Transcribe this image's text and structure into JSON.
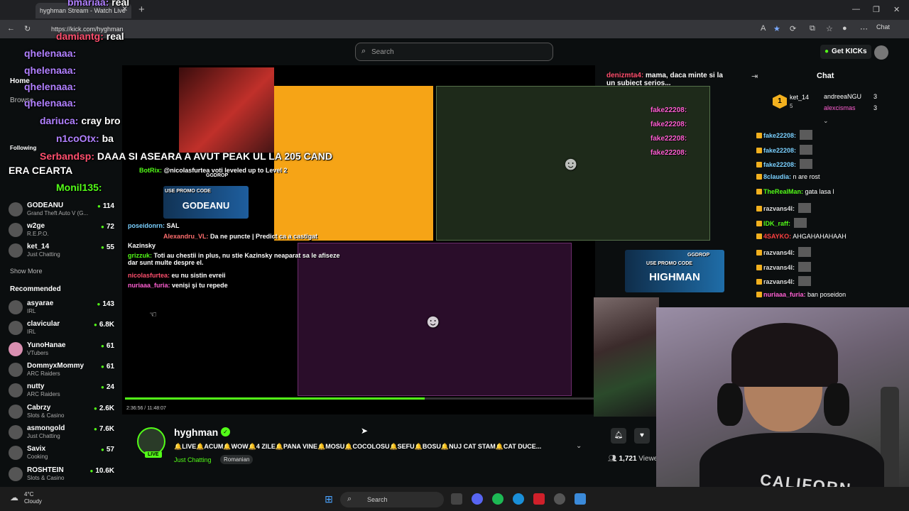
{
  "browser": {
    "tab_title": "hyghman Stream - Watch Live",
    "url": "https://kick.com/hyghman",
    "chat_button": "Chat"
  },
  "header": {
    "search_placeholder": "Search",
    "get_kicks": "Get KICKs"
  },
  "sidebar": {
    "nav": [
      "Home",
      "Browse"
    ],
    "following_label": "Following",
    "following": [
      {
        "name": "GODEANU",
        "category": "Grand Theft Auto V (G...",
        "viewers": "114"
      },
      {
        "name": "w2ge",
        "category": "R.E.P.O.",
        "viewers": "72"
      },
      {
        "name": "ket_14",
        "category": "Just Chatting",
        "viewers": "55"
      }
    ],
    "show_more": "Show More",
    "recommended_label": "Recommended",
    "recommended": [
      {
        "name": "asyarae",
        "category": "IRL",
        "viewers": "143"
      },
      {
        "name": "clavicular",
        "category": "IRL",
        "viewers": "6.8K"
      },
      {
        "name": "YunoHanae",
        "category": "VTubers",
        "viewers": "61"
      },
      {
        "name": "DommyxMommy",
        "category": "ARC Raiders",
        "viewers": "61"
      },
      {
        "name": "nutty",
        "category": "ARC Raiders",
        "viewers": "24"
      },
      {
        "name": "Cabrzy",
        "category": "Slots & Casino",
        "viewers": "2.6K"
      },
      {
        "name": "asmongold",
        "category": "Just Chatting",
        "viewers": "7.6K"
      },
      {
        "name": "Savix",
        "category": "Cooking",
        "viewers": "57"
      },
      {
        "name": "ROSHTEIN",
        "category": "Slots & Casino",
        "viewers": "10.6K"
      }
    ]
  },
  "overlay": {
    "lines": [
      {
        "user": "bmariaa:",
        "text": "real"
      },
      {
        "user": "damiantg:",
        "text": "real"
      },
      {
        "user": "qhelenaaa:",
        "text": ""
      },
      {
        "user": "qhelenaaa:",
        "text": ""
      },
      {
        "user": "qhelenaaa:",
        "text": ""
      },
      {
        "user": "qhelenaaa:",
        "text": ""
      },
      {
        "user": "dariuca:",
        "text": "cray bro"
      },
      {
        "user": "n1coOtx:",
        "text": "ba"
      },
      {
        "user": "Serbandsp:",
        "text": "DAAA SI ASEARA A AVUT PEAK UL LA 205 CAND"
      },
      {
        "user": "",
        "text": "ERA CEARTA"
      },
      {
        "user": "Monil135:",
        "text": ""
      }
    ],
    "top_right_chat": [
      {
        "user": "denizmta4:",
        "text": "mama, daca minte si la un subiect serios..."
      },
      {
        "user": "fake22208:",
        "text": ""
      },
      {
        "user": "fake22208:",
        "text": ""
      },
      {
        "user": "fake22208:",
        "text": ""
      },
      {
        "user": "fake22208:",
        "text": ""
      }
    ],
    "stream_chat": [
      {
        "user": "BotRix:",
        "text": "@nicolasfurtea voti leveled up to Level 2"
      },
      {
        "user": "poseidonrn:",
        "text": "SAL"
      },
      {
        "user": "Alexandru_VL:",
        "text": "Da ne puncte | Predict ca a castigat"
      },
      {
        "user": "Kazinsky",
        "text": ""
      },
      {
        "user": "grizzuk:",
        "text": "Toti au chestii in plus, nu stie Kazinsky neaparat sa le afiseze dar sunt multe despre el."
      },
      {
        "user": "nicolasfurtea:",
        "text": "eu nu sistin evreii"
      },
      {
        "user": "nuriaaa_furia:",
        "text": "venişi şi tu repede"
      }
    ],
    "promo_left": "GODEANU",
    "promo_right": "HIGHMAN",
    "promo_caption": "USE PROMO CODE",
    "promo_brand": "GGDROP"
  },
  "player": {
    "progress": 0.64,
    "time": "2:36:56 / 11:48:07"
  },
  "stream": {
    "streamer": "hyghman",
    "live_badge": "LIVE",
    "title": "🔔LIVE🔔ACUM🔔WOW🔔4 ZILE🔔PANA VINE🔔MOSU🔔COCOLOSU🔔SEFU🔔BOSU🔔NUJ CAT STAM🔔CAT DUCE...",
    "category": "Just Chatting",
    "language": "Romanian",
    "viewers": "1,721",
    "viewers_label": "Viewers"
  },
  "chat": {
    "title": "Chat",
    "gifters": [
      {
        "rank": "1",
        "user": "ket_14",
        "count": "5"
      },
      {
        "rank": "",
        "user": "andreeaNGU",
        "count": "3"
      },
      {
        "rank": "",
        "user": "alexcismas",
        "count": "3"
      }
    ],
    "messages": [
      {
        "user": "fake22208:",
        "text": "",
        "color": "#7ad0ff"
      },
      {
        "user": "fake22208:",
        "text": "",
        "color": "#7ad0ff"
      },
      {
        "user": "fake22208:",
        "text": "",
        "color": "#7ad0ff"
      },
      {
        "user": "8claudia:",
        "text": "n are rost",
        "color": "#7ad0ff"
      },
      {
        "user": "TheRealMan:",
        "text": "gata lasa l",
        "color": "#53fc18"
      },
      {
        "user": "razvans4l:",
        "text": "",
        "color": "#dddddd"
      },
      {
        "user": "IDK_raff:",
        "text": "",
        "color": "#53fc18"
      },
      {
        "user": "4SAYKO:",
        "text": "AHGAHAHAHAAH",
        "color": "#ff4040"
      },
      {
        "user": "razvans4l:",
        "text": "",
        "color": "#dddddd"
      },
      {
        "user": "razvans4l:",
        "text": "",
        "color": "#dddddd"
      },
      {
        "user": "razvans4l:",
        "text": "",
        "color": "#dddddd"
      },
      {
        "user": "nuriaaa_furia:",
        "text": "ban poseidon",
        "color": "#ff5fd2"
      }
    ]
  },
  "overlay_shirt": "CALIFORN",
  "taskbar": {
    "temp": "4°C",
    "weather": "Cloudy",
    "search_placeholder": "Search"
  },
  "colors": {
    "accent": "#53fc18",
    "bg": "#0b0e0f",
    "orange": "#f6a416"
  }
}
